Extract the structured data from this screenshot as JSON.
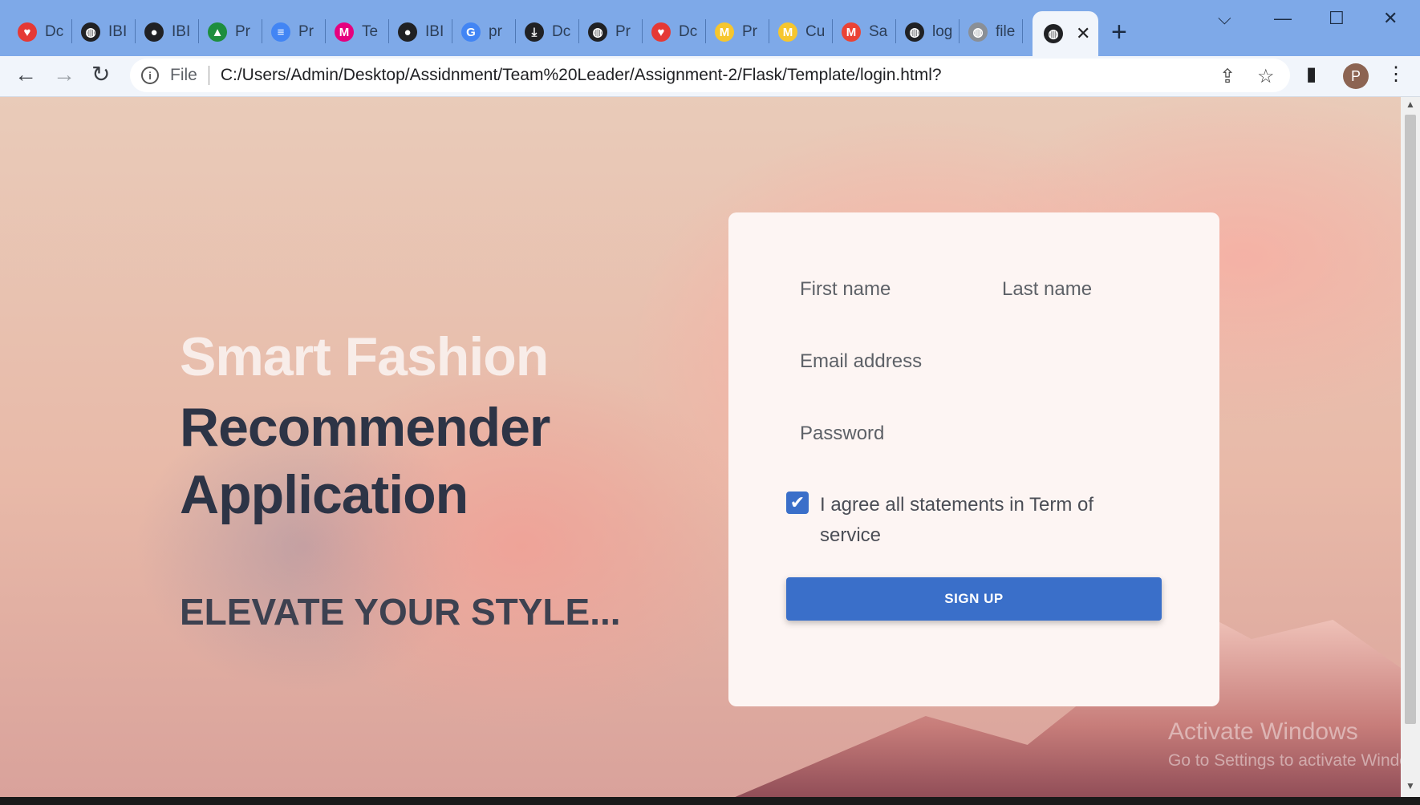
{
  "browser": {
    "tabs": [
      {
        "icon": "heart-icon",
        "label": "Dc",
        "color": "#e53935"
      },
      {
        "icon": "globe-icon",
        "label": "IBI",
        "color": "#202124"
      },
      {
        "icon": "github-icon",
        "label": "IBI",
        "color": "#202124"
      },
      {
        "icon": "google-drive-icon",
        "label": "Pr",
        "color": "#1e8e3e"
      },
      {
        "icon": "google-docs-icon",
        "label": "Pr",
        "color": "#4285f4"
      },
      {
        "icon": "miro-icon",
        "label": "Te",
        "color": "#e6007e"
      },
      {
        "icon": "github-icon",
        "label": "IBI",
        "color": "#202124"
      },
      {
        "icon": "google-icon",
        "label": "pr",
        "color": "#4285f4"
      },
      {
        "icon": "download-icon",
        "label": "Dc",
        "color": "#202124"
      },
      {
        "icon": "globe-icon",
        "label": "Pr",
        "color": "#202124"
      },
      {
        "icon": "heart-icon",
        "label": "Dc",
        "color": "#e53935"
      },
      {
        "icon": "miro-icon",
        "label": "Pr",
        "color": "#f6c62e"
      },
      {
        "icon": "miro-icon",
        "label": "Cu",
        "color": "#f6c62e"
      },
      {
        "icon": "gmail-icon",
        "label": "Sa",
        "color": "#ea4335"
      },
      {
        "icon": "globe-icon",
        "label": "log",
        "color": "#202124"
      },
      {
        "icon": "globe-icon",
        "label": "file",
        "color": "#8a8f96"
      }
    ],
    "active_tab": {
      "icon": "globe-icon",
      "close": "✕"
    },
    "new_tab": "+",
    "window_controls": {
      "dropdown": "⌵",
      "minimize": "—",
      "maximize": "☐",
      "close": "✕"
    },
    "nav": {
      "back": "←",
      "forward": "→",
      "reload": "↻"
    },
    "address": {
      "info": "i",
      "scheme_label": "File",
      "url": "C:/Users/Admin/Desktop/Assidnment/Team%20Leader/Assignment-2/Flask/Template/login.html?"
    },
    "toolbar_icons": {
      "share": "⇪",
      "star": "☆",
      "sidepanel": "▮",
      "menu": "⋮"
    },
    "profile_initial": "P"
  },
  "hero": {
    "title_line1": "Smart Fashion",
    "title_line2": "Recommender",
    "title_line3": "Application",
    "tagline": "ELEVATE YOUR STYLE..."
  },
  "form": {
    "first_name_placeholder": "First name",
    "last_name_placeholder": "Last name",
    "email_placeholder": "Email address",
    "password_placeholder": "Password",
    "agree_checked": true,
    "agree_text": "I agree all statements in Term of service",
    "submit_label": "SIGN UP"
  },
  "watermark": {
    "line1": "Activate Windows",
    "line2": "Go to Settings to activate Windows."
  },
  "colors": {
    "accent": "#3a6fc9",
    "tabstrip": "#7ea9e8",
    "hero_dark": "#2d3446",
    "hero_light": "#f8ede9"
  }
}
